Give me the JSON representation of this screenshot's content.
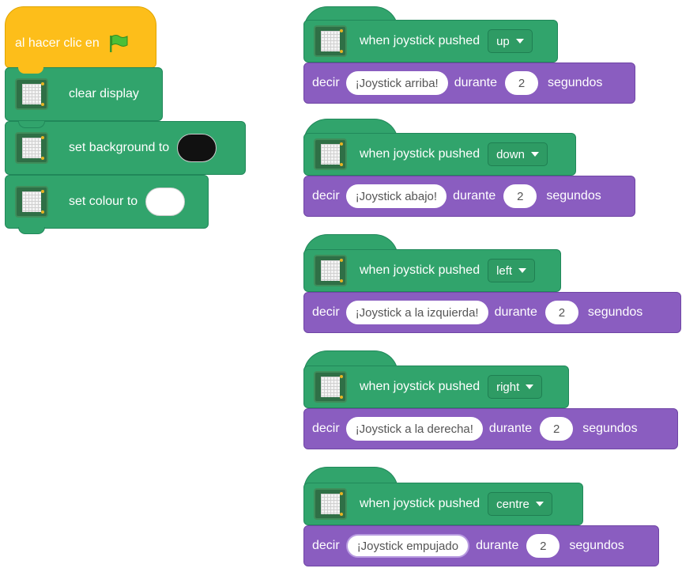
{
  "start_block": {
    "label": "al hacer clic en",
    "icon": "green-flag-icon"
  },
  "setup_blocks": [
    {
      "label": "clear display"
    },
    {
      "label": "set background to",
      "swatch_color": "#111111"
    },
    {
      "label": "set colour to",
      "swatch_color": "#ffffff"
    }
  ],
  "joystick_scripts": [
    {
      "hat_label": "when joystick pushed",
      "direction": "up",
      "say_label": "decir",
      "message": "¡Joystick arriba!",
      "duration_label": "durante",
      "seconds": "2",
      "seconds_label": "segundos"
    },
    {
      "hat_label": "when joystick pushed",
      "direction": "down",
      "say_label": "decir",
      "message": "¡Joystick abajo!",
      "duration_label": "durante",
      "seconds": "2",
      "seconds_label": "segundos"
    },
    {
      "hat_label": "when joystick pushed",
      "direction": "left",
      "say_label": "decir",
      "message": "¡Joystick a la izquierda!",
      "duration_label": "durante",
      "seconds": "2",
      "seconds_label": "segundos"
    },
    {
      "hat_label": "when joystick pushed",
      "direction": "right",
      "say_label": "decir",
      "message": "¡Joystick a la derecha!",
      "duration_label": "durante",
      "seconds": "2",
      "seconds_label": "segundos"
    },
    {
      "hat_label": "when joystick pushed",
      "direction": "centre",
      "say_label": "decir",
      "message": "¡Joystick empujado",
      "duration_label": "durante",
      "seconds": "2",
      "seconds_label": "segundos"
    }
  ],
  "colors": {
    "events": "#fdbe1a",
    "extension": "#31a46c",
    "looks": "#8a5dc0"
  }
}
